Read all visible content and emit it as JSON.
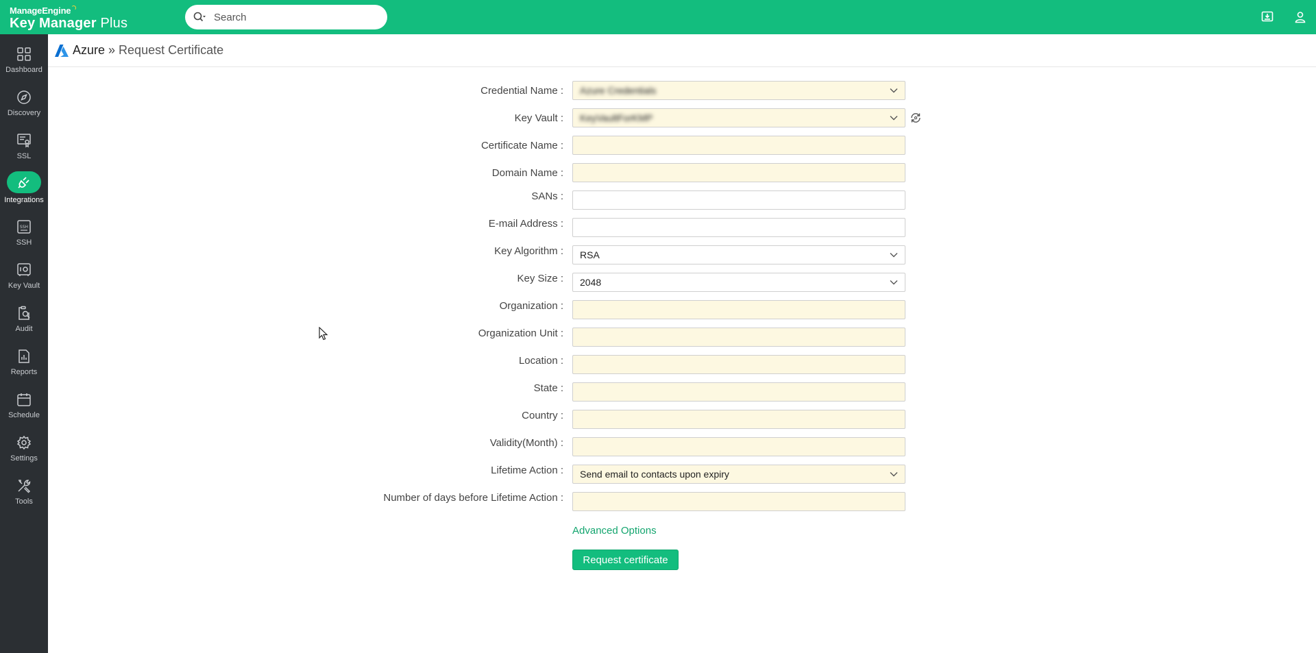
{
  "brand": {
    "vendor": "ManageEngine",
    "product_bold": "Key Manager",
    "product_rest": " Plus"
  },
  "search": {
    "placeholder": "Search"
  },
  "colors": {
    "accent": "#13bd7e",
    "sidebar": "#2b2f33",
    "field_bg": "#fdf8e1",
    "link": "#13a56e"
  },
  "sidebar": {
    "items": [
      {
        "label": "Dashboard",
        "icon": "dashboard-icon"
      },
      {
        "label": "Discovery",
        "icon": "compass-icon"
      },
      {
        "label": "SSL",
        "icon": "certificate-icon"
      },
      {
        "label": "Integrations",
        "icon": "plug-icon",
        "active": true
      },
      {
        "label": "SSH",
        "icon": "ssh-terminal-icon"
      },
      {
        "label": "Key Vault",
        "icon": "vault-icon"
      },
      {
        "label": "Audit",
        "icon": "audit-icon"
      },
      {
        "label": "Reports",
        "icon": "reports-icon"
      },
      {
        "label": "Schedule",
        "icon": "calendar-icon"
      },
      {
        "label": "Settings",
        "icon": "gear-icon"
      },
      {
        "label": "Tools",
        "icon": "tools-icon"
      }
    ]
  },
  "breadcrumb": {
    "root": "Azure",
    "separator": "»",
    "current": "Request Certificate"
  },
  "form": {
    "credential_name": {
      "label": "Credential Name :",
      "value": "Azure Credentials"
    },
    "key_vault": {
      "label": "Key Vault :",
      "value": "KeyVaultForKMP"
    },
    "certificate_name": {
      "label": "Certificate Name :",
      "value": ""
    },
    "domain_name": {
      "label": "Domain Name :",
      "value": ""
    },
    "sans": {
      "label": "SANs :",
      "value": ""
    },
    "email": {
      "label": "E-mail Address :",
      "value": ""
    },
    "key_algorithm": {
      "label": "Key Algorithm :",
      "value": "RSA"
    },
    "key_size": {
      "label": "Key Size :",
      "value": "2048"
    },
    "organization": {
      "label": "Organization :",
      "value": ""
    },
    "organization_unit": {
      "label": "Organization Unit :",
      "value": ""
    },
    "location": {
      "label": "Location :",
      "value": ""
    },
    "state": {
      "label": "State :",
      "value": ""
    },
    "country": {
      "label": "Country :",
      "value": ""
    },
    "validity": {
      "label": "Validity(Month) :",
      "value": ""
    },
    "lifetime_action": {
      "label": "Lifetime Action :",
      "value": "Send email to contacts upon expiry"
    },
    "days_before": {
      "label": "Number of days before Lifetime Action :",
      "value": ""
    }
  },
  "advanced_options_label": "Advanced Options",
  "submit_label": "Request certificate"
}
